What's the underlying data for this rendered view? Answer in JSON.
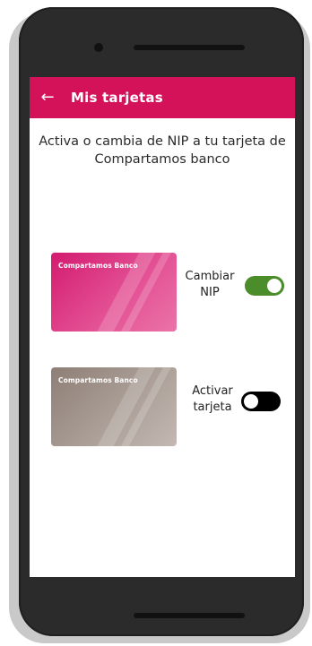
{
  "app_bar": {
    "back_icon": "arrow-left-icon",
    "back_glyph": "←",
    "title": "Mis tarjetas",
    "color": "#d3125a"
  },
  "subtitle": "Activa o cambia de NIP a tu tarjeta de Compartamos banco",
  "cards": [
    {
      "brand": "Compartamos Banco",
      "label_line1": "Cambiar",
      "label_line2": "NIP",
      "toggle_on": true,
      "card_color": "#d31b6f",
      "toggle_color": "#4b8c2b"
    },
    {
      "brand": "Compartamos Banco",
      "label_line1": "Activar",
      "label_line2": "tarjeta",
      "toggle_on": false,
      "card_color": "#8e7f76",
      "toggle_color": "#000000"
    }
  ]
}
